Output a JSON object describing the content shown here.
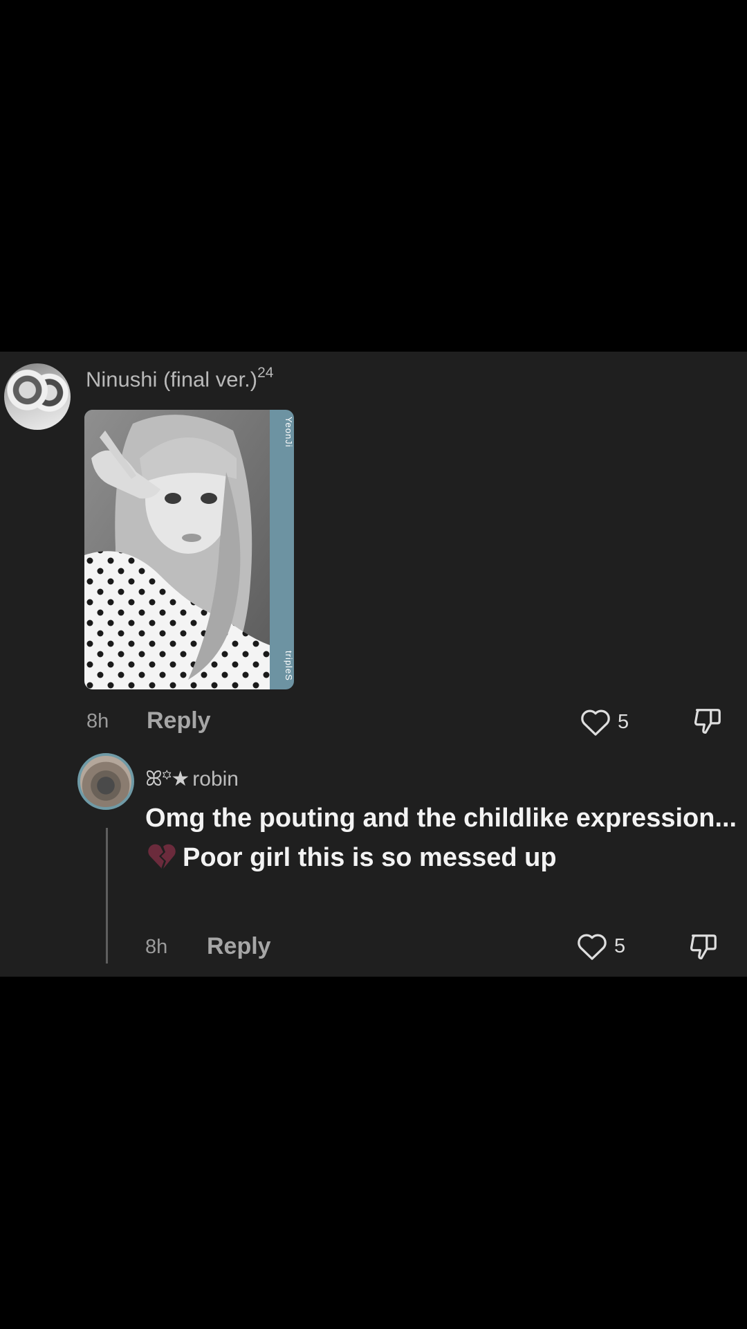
{
  "comment": {
    "username": "Ninushi (final ver.)",
    "username_sup": "24",
    "photo_card": {
      "strip_top": "YeonJi",
      "strip_bottom": "tripleS"
    },
    "time": "8h",
    "reply_label": "Reply",
    "likes": "5",
    "icons": {
      "like": "heart-outline-icon",
      "dislike": "thumbs-down-icon"
    }
  },
  "reply_comment": {
    "username_decoration": "ꕤ꙳★",
    "username": "robin",
    "text_before_emoji": "Omg the pouting and the childlike expression...",
    "emoji": "broken-heart-emoji",
    "text_after_emoji": "Poor girl this is so messed up",
    "time": "8h",
    "reply_label": "Reply",
    "likes": "5",
    "colors": {
      "avatar_ring": "#6f9aa6",
      "thread_line": "#5e5e5e"
    }
  },
  "colors": {
    "page_background": "#000000",
    "panel_background": "#1f1f1f",
    "card_strip": "#6d93a2",
    "text_primary": "#f3f3f3",
    "text_secondary": "#a6a6a6"
  }
}
